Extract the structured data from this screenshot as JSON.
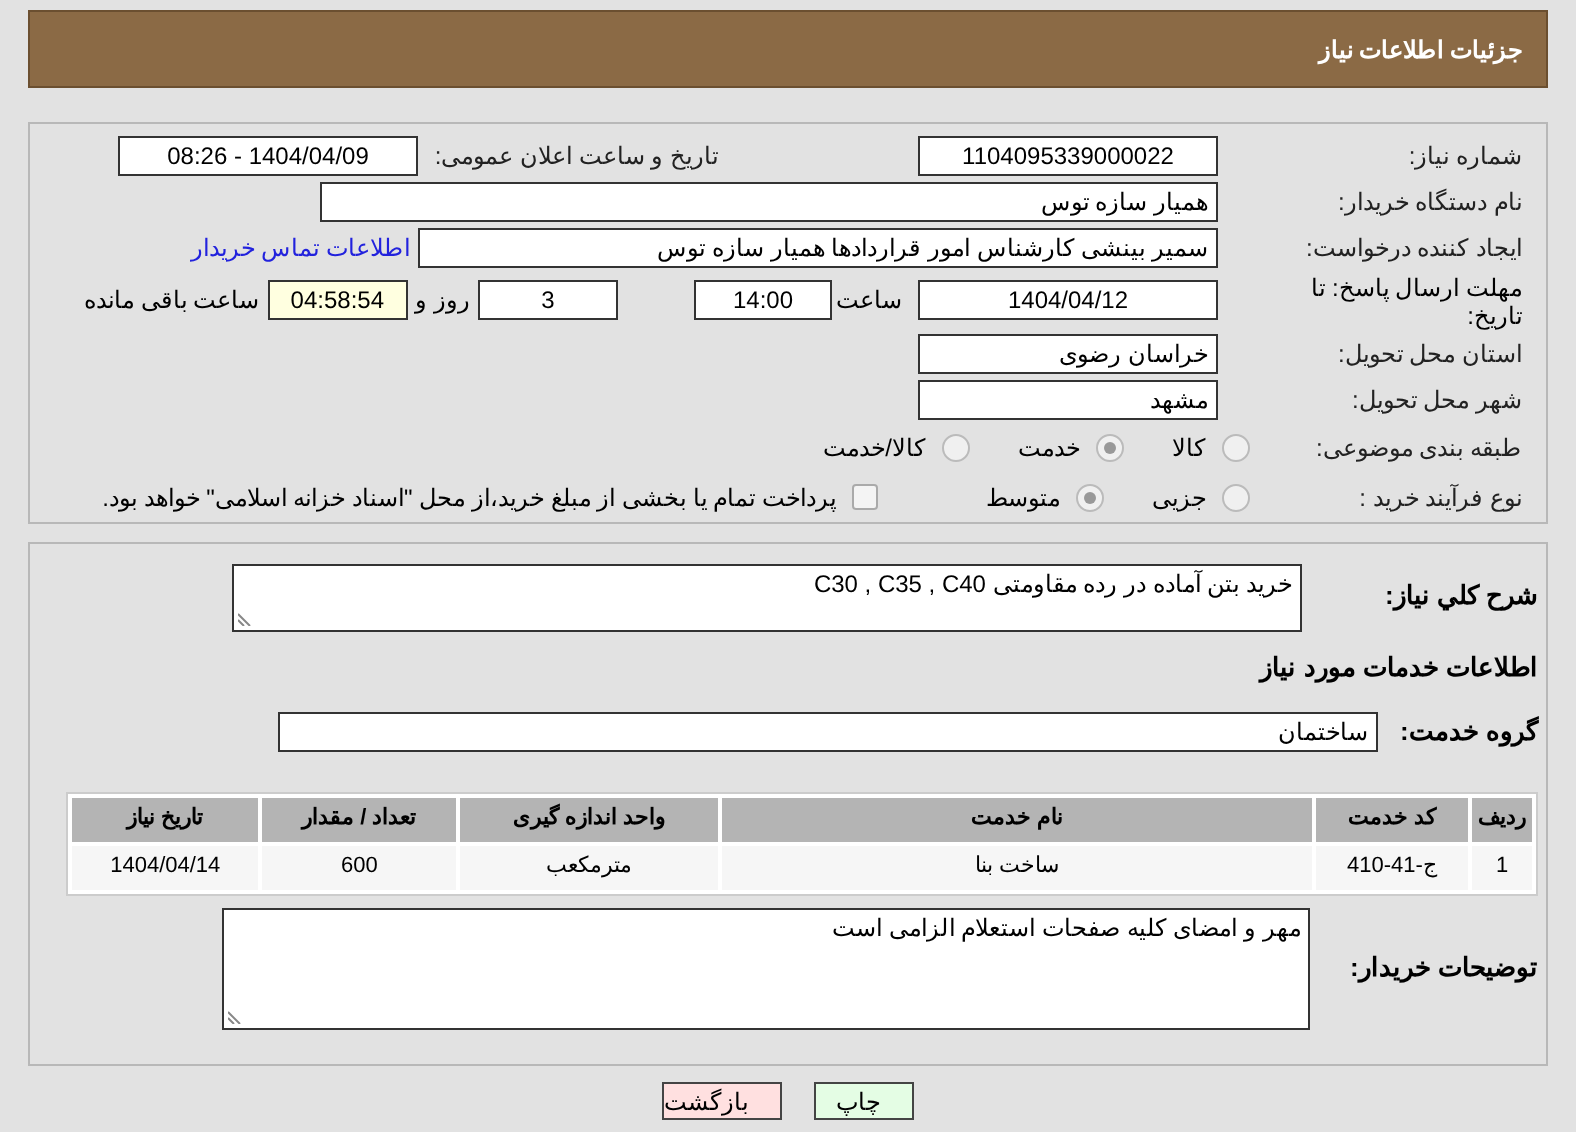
{
  "header": {
    "title": "جزئیات اطلاعات نیاز"
  },
  "need_number": {
    "label": "شماره نیاز:",
    "value": "1104095339000022"
  },
  "announce_date": {
    "label": "تاریخ و ساعت اعلان عمومی:",
    "value": "1404/04/09 - 08:26"
  },
  "buyer_org": {
    "label": "نام دستگاه خریدار:",
    "value": "همیار سازه توس"
  },
  "requester": {
    "label": "ایجاد کننده درخواست:",
    "value": "سمیر بینشی کارشناس امور قراردادها همیار سازه توس",
    "link": "اطلاعات تماس خریدار"
  },
  "deadline": {
    "label": "مهلت ارسال پاسخ: تا تاریخ:",
    "date": "1404/04/12",
    "time_label": "ساعت",
    "time": "14:00",
    "days": "3",
    "days_label": "روز و",
    "remaining": "04:58:54",
    "remaining_label": "ساعت باقی مانده"
  },
  "province": {
    "label": "استان محل تحویل:",
    "value": "خراسان رضوی"
  },
  "city": {
    "label": "شهر محل تحویل:",
    "value": "مشهد"
  },
  "category": {
    "label": "طبقه بندی موضوعی:",
    "options": [
      {
        "label": "کالا",
        "selected": false,
        "disabled": true
      },
      {
        "label": "خدمت",
        "selected": true,
        "disabled": true
      },
      {
        "label": "کالا/خدمت",
        "selected": false,
        "disabled": true
      }
    ]
  },
  "process": {
    "label": "نوع فرآیند خرید :",
    "options": [
      {
        "label": "جزیی",
        "selected": false,
        "disabled": true
      },
      {
        "label": "متوسط",
        "selected": true,
        "disabled": true
      }
    ],
    "treasury": {
      "checked": false,
      "label": "پرداخت تمام یا بخشی از مبلغ خرید،از محل \"اسناد خزانه اسلامی\" خواهد بود."
    }
  },
  "description": {
    "label": "شرح کلي نياز:",
    "value": "خرید بتن آماده در رده مقاومتی C30 , C35 , C40"
  },
  "services_title": "اطلاعات خدمات مورد نیاز",
  "service_group": {
    "label": "گروه خدمت:",
    "value": "ساختمان"
  },
  "table": {
    "columns": [
      "ردیف",
      "کد خدمت",
      "نام خدمت",
      "واحد اندازه گیری",
      "تعداد / مقدار",
      "تاریخ نیاز"
    ],
    "rows": [
      [
        "1",
        "ج-41-410",
        "ساخت بنا",
        "مترمکعب",
        "600",
        "1404/04/14"
      ]
    ]
  },
  "buyer_notes": {
    "label": "توضیحات خریدار:",
    "value": "مهر و امضای کلیه صفحات استعلام الزامی است"
  },
  "buttons": [
    {
      "label": "چاپ",
      "kind": "print"
    },
    {
      "label": "بازگشت",
      "kind": "back"
    }
  ]
}
